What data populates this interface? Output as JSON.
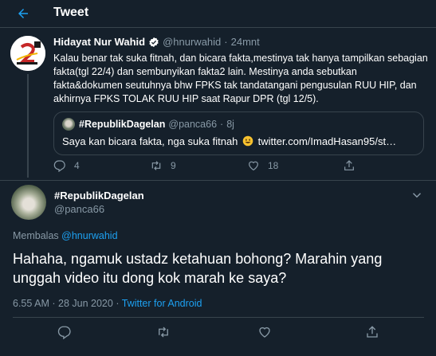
{
  "header": {
    "title": "Tweet",
    "back_icon": "arrow-left-icon"
  },
  "colors": {
    "background": "#15202b",
    "accent": "#1da1f2",
    "muted": "#8899a6",
    "border": "#38444d"
  },
  "parent_tweet": {
    "name": "Hidayat Nur Wahid",
    "handle": "@hnurwahid",
    "dot": "·",
    "time": "24mnt",
    "text": "Kalau benar tak suka fitnah, dan bicara fakta,mestinya tak hanya tampilkan sebagian fakta(tgl 22/4) dan sembunyikan fakta2 lain. Mestinya anda sebutkan fakta&dokumen seutuhnya bhw FPKS tak tandatangani pengusulan RUU HIP, dan akhirnya FPKS TOLAK RUU HIP saat Rapur DPR (tgl 12/5).",
    "quoted": {
      "name": "#RepublikDagelan",
      "handle": "@panca66",
      "dot": "·",
      "time": "8j",
      "text_before": "Saya kan bicara fakta, nga suka fitnah",
      "link": "twitter.com/ImadHasan95/st…"
    },
    "actions": {
      "replies": "4",
      "retweets": "9",
      "likes": "18"
    }
  },
  "main_tweet": {
    "name": "#RepublikDagelan",
    "handle": "@panca66",
    "reply_label": "Membalas",
    "reply_to": "@hnurwahid",
    "text": "Hahaha, ngamuk ustadz ketahuan bohong? Marahin yang unggah video itu dong kok marah ke saya?",
    "time": "6.55 AM",
    "dot": "·",
    "date": "28 Jun 2020",
    "source": "Twitter for Android"
  }
}
